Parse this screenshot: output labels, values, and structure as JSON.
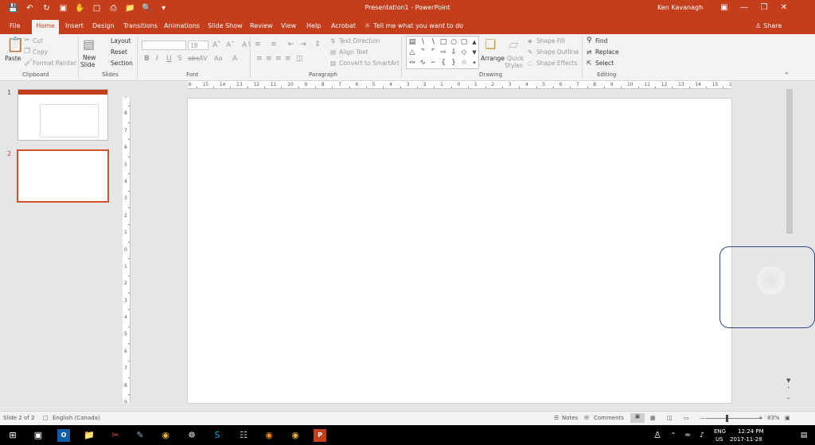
{
  "window": {
    "title": "Presentation1 - PowerPoint",
    "user": "Ken Kavanagh"
  },
  "tabs": [
    "File",
    "Home",
    "Insert",
    "Design",
    "Transitions",
    "Animations",
    "Slide Show",
    "Review",
    "View",
    "Help",
    "Acrobat"
  ],
  "active_tab": "Home",
  "tell_me": "Tell me what you want to do",
  "share_label": "Share",
  "ribbon": {
    "clipboard": {
      "paste": "Paste",
      "cut": "Cut",
      "copy": "Copy",
      "format_painter": "Format Painter",
      "label": "Clipboard"
    },
    "slides": {
      "new_slide_1": "New",
      "new_slide_2": "Slide",
      "layout": "Layout",
      "reset": "Reset",
      "section": "Section",
      "label": "Slides"
    },
    "font": {
      "size": "18",
      "label": "Font"
    },
    "paragraph": {
      "text_direction": "Text Direction",
      "align_text": "Align Text",
      "smartart": "Convert to SmartArt",
      "label": "Paragraph"
    },
    "drawing": {
      "arrange": "Arrange",
      "quick_styles_1": "Quick",
      "quick_styles_2": "Styles",
      "shape_fill": "Shape Fill",
      "shape_outline": "Shape Outline",
      "shape_effects": "Shape Effects",
      "label": "Drawing"
    },
    "editing": {
      "find": "Find",
      "replace": "Replace",
      "select": "Select",
      "label": "Editing"
    }
  },
  "thumbnails": [
    {
      "number": "1",
      "selected": false
    },
    {
      "number": "2",
      "selected": true
    }
  ],
  "ruler": {
    "horizontal": [
      "16",
      "15",
      "14",
      "13",
      "12",
      "11",
      "10",
      "9",
      "8",
      "7",
      "6",
      "5",
      "4",
      "3",
      "2",
      "1",
      "0",
      "1",
      "2",
      "3",
      "4",
      "5",
      "6",
      "7",
      "8",
      "9",
      "10",
      "11",
      "12",
      "13",
      "14",
      "15",
      "16"
    ],
    "vertical": [
      "9",
      "8",
      "7",
      "6",
      "5",
      "4",
      "3",
      "2",
      "1",
      "0",
      "1",
      "2",
      "3",
      "4",
      "5",
      "6",
      "7",
      "8",
      "9"
    ]
  },
  "status": {
    "slide": "Slide 2 of 2",
    "language": "English (Canada)",
    "notes": "Notes",
    "comments": "Comments",
    "zoom": "83%"
  },
  "taskbar": {
    "lang_1": "ENG",
    "lang_2": "US",
    "time": "12:24 PM",
    "date": "2017-11-28"
  },
  "colors": {
    "accent": "#c43e1c",
    "selection": "#d35230",
    "taskbar": "#000000"
  }
}
